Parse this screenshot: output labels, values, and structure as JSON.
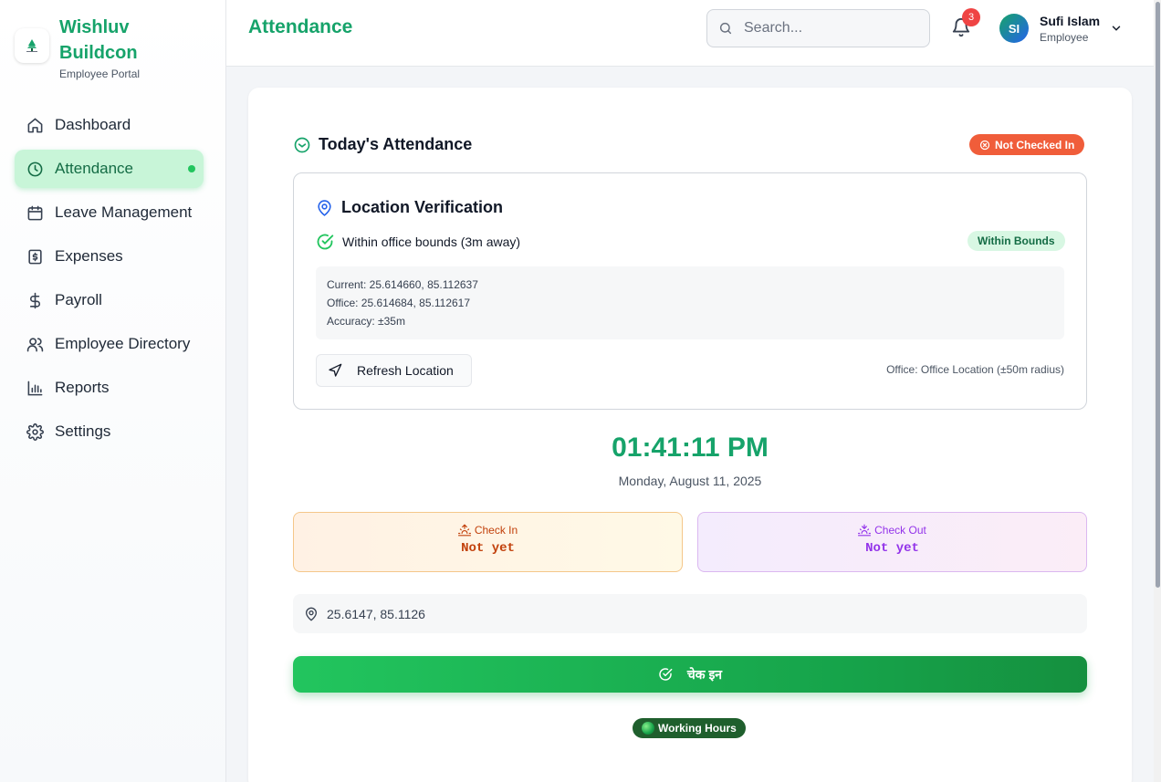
{
  "brand": {
    "name_line1": "Wishluv",
    "name_line2": "Buildcon",
    "subtitle": "Employee Portal"
  },
  "sidebar": {
    "items": [
      {
        "label": "Dashboard",
        "icon": "home-icon",
        "active": false
      },
      {
        "label": "Attendance",
        "icon": "clock-icon",
        "active": true
      },
      {
        "label": "Leave Management",
        "icon": "calendar-icon",
        "active": false
      },
      {
        "label": "Expenses",
        "icon": "receipt-dollar-icon",
        "active": false
      },
      {
        "label": "Payroll",
        "icon": "dollar-icon",
        "active": false
      },
      {
        "label": "Employee Directory",
        "icon": "users-icon",
        "active": false
      },
      {
        "label": "Reports",
        "icon": "bar-chart-icon",
        "active": false
      },
      {
        "label": "Settings",
        "icon": "gear-icon",
        "active": false
      }
    ]
  },
  "header": {
    "title": "Attendance",
    "search_placeholder": "Search...",
    "notification_count": "3",
    "user": {
      "initials": "SI",
      "name": "Sufi Islam",
      "role": "Employee"
    }
  },
  "attendance": {
    "section_title": "Today's Attendance",
    "status_badge": "Not Checked In",
    "location": {
      "title": "Location Verification",
      "bounds_text": "Within office bounds (3m away)",
      "bounds_badge": "Within Bounds",
      "current": "Current: 25.614660, 85.112637",
      "office": "Office: 25.614684, 85.112617",
      "accuracy": "Accuracy: ±35m",
      "refresh_label": "Refresh Location",
      "office_note": "Office: Office Location (±50m radius)"
    },
    "clock": "01:41:11 PM",
    "date": "Monday, August 11, 2025",
    "check_in": {
      "label": "Check In",
      "value": "Not yet"
    },
    "check_out": {
      "label": "Check Out",
      "value": "Not yet"
    },
    "gps": "25.6147, 85.1126",
    "checkin_button": "चेक इन",
    "working_hours": "Working Hours"
  },
  "colors": {
    "brand_green": "#16a36a",
    "status_red": "#f05d3a",
    "checkin_orange": "#c2410c",
    "checkout_purple": "#9333ea"
  }
}
